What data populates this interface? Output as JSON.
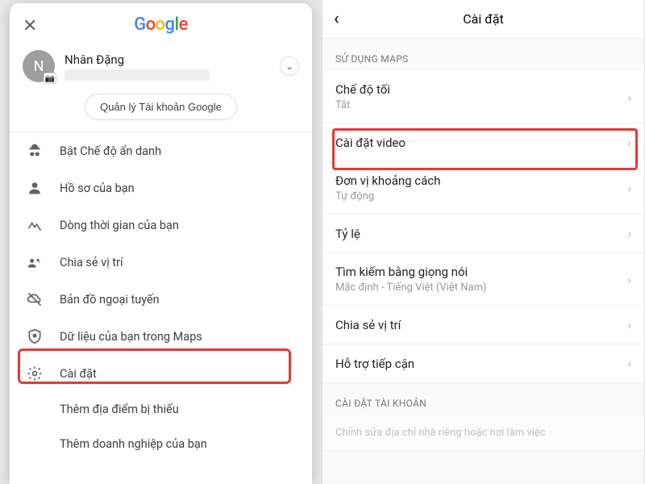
{
  "left": {
    "logo_letters": [
      "G",
      "o",
      "o",
      "g",
      "l",
      "e"
    ],
    "account": {
      "initial": "N",
      "name": "Nhân Đặng"
    },
    "manage_account": "Quản lý Tài khoản Google",
    "menu": [
      "Bật Chế độ ẩn danh",
      "Hồ sơ của bạn",
      "Dòng thời gian của bạn",
      "Chia sẻ vị trí",
      "Bản đồ ngoại tuyến",
      "Dữ liệu của bạn trong Maps",
      "Cài đặt",
      "Thêm địa điểm bị thiếu",
      "Thêm doanh nghiệp của bạn"
    ]
  },
  "right": {
    "title": "Cài đặt",
    "section_maps": "SỬ DỤNG MAPS",
    "rows": [
      {
        "title": "Chế độ tối",
        "sub": "Tắt"
      },
      {
        "title": "Cài đặt video",
        "sub": ""
      },
      {
        "title": "Đơn vị khoảng cách",
        "sub": "Tự động"
      },
      {
        "title": "Tỷ lệ",
        "sub": ""
      },
      {
        "title": "Tìm kiếm bằng giọng nói",
        "sub": "Mặc định - Tiếng Việt (Việt Nam)"
      },
      {
        "title": "Chia sẻ vị trí",
        "sub": ""
      },
      {
        "title": "Hỗ trợ tiếp cận",
        "sub": ""
      }
    ],
    "section_account": "CÀI ĐẶT TÀI KHOẢN",
    "bottom_hint": "Chỉnh sửa địa chỉ nhà riêng hoặc nơi làm việc"
  }
}
